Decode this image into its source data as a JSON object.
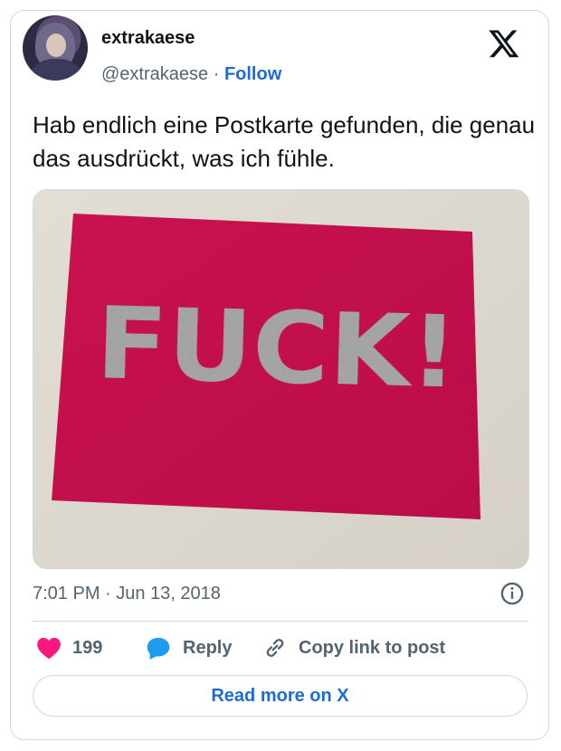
{
  "author": {
    "display_name": "extrakaese",
    "handle": "@extrakaese",
    "separator": "·",
    "follow_label": "Follow"
  },
  "tweet": {
    "text": "Hab endlich eine Postkarte gefunden, die genau das ausdrückt, was ich fühle.",
    "media": {
      "postcard_text": "FUCK!",
      "postcard_color": "#c3114f",
      "lettering_color": "#9a9a9e"
    },
    "timestamp": "7:01 PM · Jun 13, 2018"
  },
  "actions": {
    "like_count": "199",
    "reply_label": "Reply",
    "copy_link_label": "Copy link to post"
  },
  "read_more_label": "Read more on X",
  "icons": [
    "x-logo-icon",
    "info-icon",
    "heart-icon",
    "reply-bubble-icon",
    "link-icon"
  ],
  "colors": {
    "accent": "#1d6bd8",
    "heart": "#f91880",
    "reply_bubble": "#1d9bf0",
    "secondary_text": "#536471",
    "border": "#cfd9de"
  }
}
